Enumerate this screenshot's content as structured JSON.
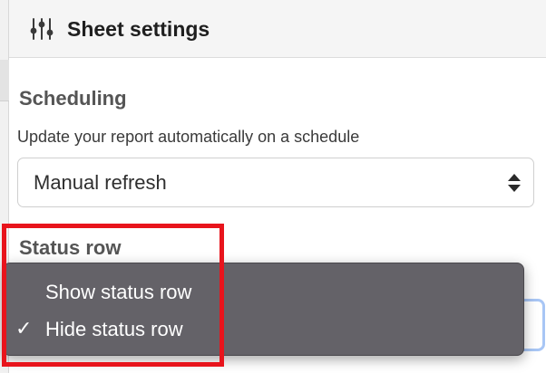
{
  "header": {
    "title": "Sheet settings",
    "icon": "sliders-icon"
  },
  "scheduling": {
    "title": "Scheduling",
    "description": "Update your report automatically on a schedule",
    "selected_value": "Manual refresh",
    "arrows_icon": "select-arrows-icon"
  },
  "status_row": {
    "title": "Status row",
    "options": [
      {
        "label": "Show status row",
        "checked": false
      },
      {
        "label": "Hide status row",
        "checked": true
      }
    ],
    "check_glyph": "✓"
  },
  "colors": {
    "menu_background": "#646268",
    "highlight": "#e8141c",
    "focus_ring": "#a8c6f5"
  }
}
